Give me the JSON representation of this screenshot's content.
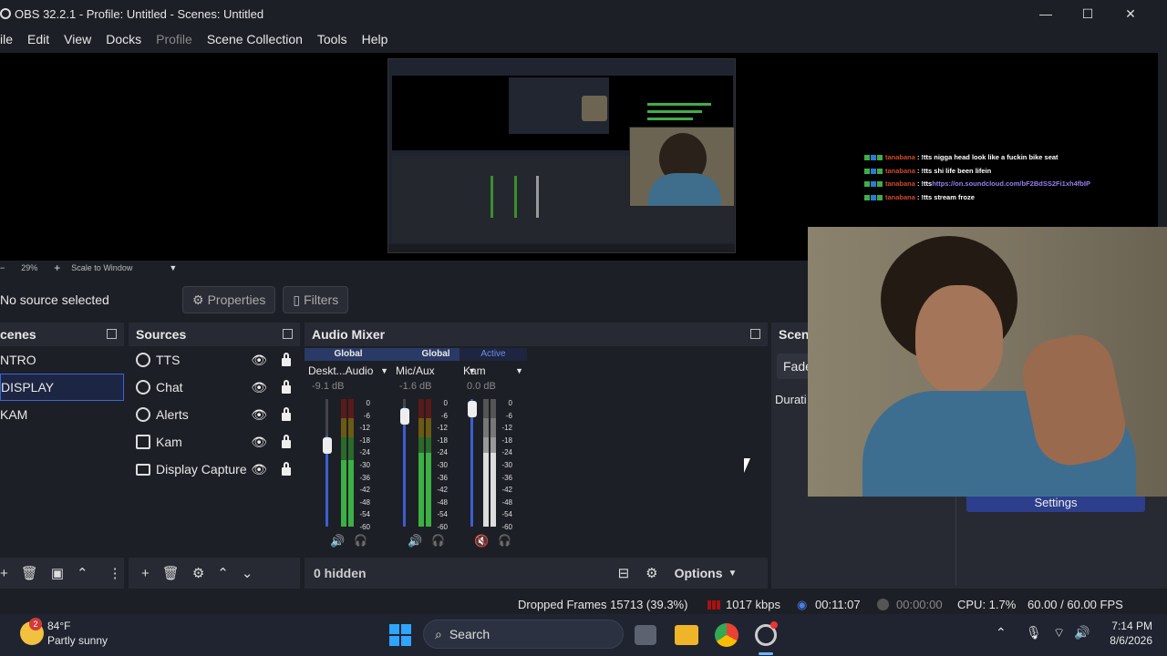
{
  "window": {
    "title": "OBS 32.2.1 - Profile: Untitled - Scenes: Untitled",
    "minimize": "—",
    "maximize": "☐",
    "close": "✕"
  },
  "menu": {
    "file": "ile",
    "edit": "Edit",
    "view": "View",
    "docks": "Docks",
    "profile": "Profile",
    "scene_collection": "Scene Collection",
    "tools": "Tools",
    "help": "Help"
  },
  "zoom": {
    "minus": "−",
    "value": "29%",
    "plus": "+",
    "mode": "Scale to Window"
  },
  "source_toolbar": {
    "no_source": "No source selected",
    "properties": "Properties",
    "filters": "Filters"
  },
  "scenes": {
    "title": "cenes",
    "items": [
      "NTRO",
      "DISPLAY",
      "KAM"
    ],
    "selected_index": 1
  },
  "sources": {
    "title": "Sources",
    "items": [
      {
        "label": "TTS",
        "icon": "globe-icon"
      },
      {
        "label": "Chat",
        "icon": "globe-icon"
      },
      {
        "label": "Alerts",
        "icon": "globe-icon"
      },
      {
        "label": "Kam",
        "icon": "camera-icon"
      },
      {
        "label": "Display Capture",
        "icon": "monitor-icon"
      }
    ]
  },
  "mixer": {
    "title": "Audio Mixer",
    "channels": [
      {
        "status": "Global",
        "name": "Deskt...Audio",
        "db": "-9.1 dB",
        "volume_level": 0.72,
        "muted": false
      },
      {
        "status": "Global",
        "name": "Mic/Aux",
        "db": "-1.6 dB",
        "volume_level": 0.95,
        "muted": false
      },
      {
        "status": "Active",
        "name": "Kam",
        "db": "0.0 dB",
        "volume_level": 1.0,
        "muted": true
      }
    ],
    "ticks": [
      "0",
      "-6",
      "-12",
      "-18",
      "-24",
      "-30",
      "-36",
      "-42",
      "-48",
      "-54",
      "-60"
    ],
    "hidden": "0 hidden",
    "options": "Options"
  },
  "transitions": {
    "title": "Scene",
    "fade": "Fade",
    "duration": "Durati"
  },
  "settings_button": "Settings",
  "chat_overlay": [
    {
      "user": "tanabana",
      "text": ": !tts nigga head look like a fuckin bike seat",
      "link": ""
    },
    {
      "user": "tanabana",
      "text": ": !tts shi life been lifein",
      "link": ""
    },
    {
      "user": "tanabana",
      "text": ": !tts ",
      "link": "https://on.soundcloud.com/bF2BdSS2Fi1xh4fbIP"
    },
    {
      "user": "tanabana",
      "text": ": !tts stream froze",
      "link": ""
    }
  ],
  "status": {
    "dropped": "Dropped Frames 15713 (39.3%)",
    "kbps": "1017 kbps",
    "live_time": "00:11:07",
    "rec_time": "00:00:00",
    "cpu": "CPU: 1.7%",
    "fps": "60.00 / 60.00 FPS"
  },
  "taskbar": {
    "weather_temp": "84°F",
    "weather_desc": "Partly sunny",
    "weather_badge": "2",
    "search": "Search",
    "time": "7:14 PM",
    "date": "8/6/2026"
  },
  "colors": {
    "accent": "#3f62d8",
    "meter_green": "#3cb043",
    "meter_red": "#c0392b",
    "link": "#9a7df0",
    "chat_user": "#d14a2c"
  }
}
